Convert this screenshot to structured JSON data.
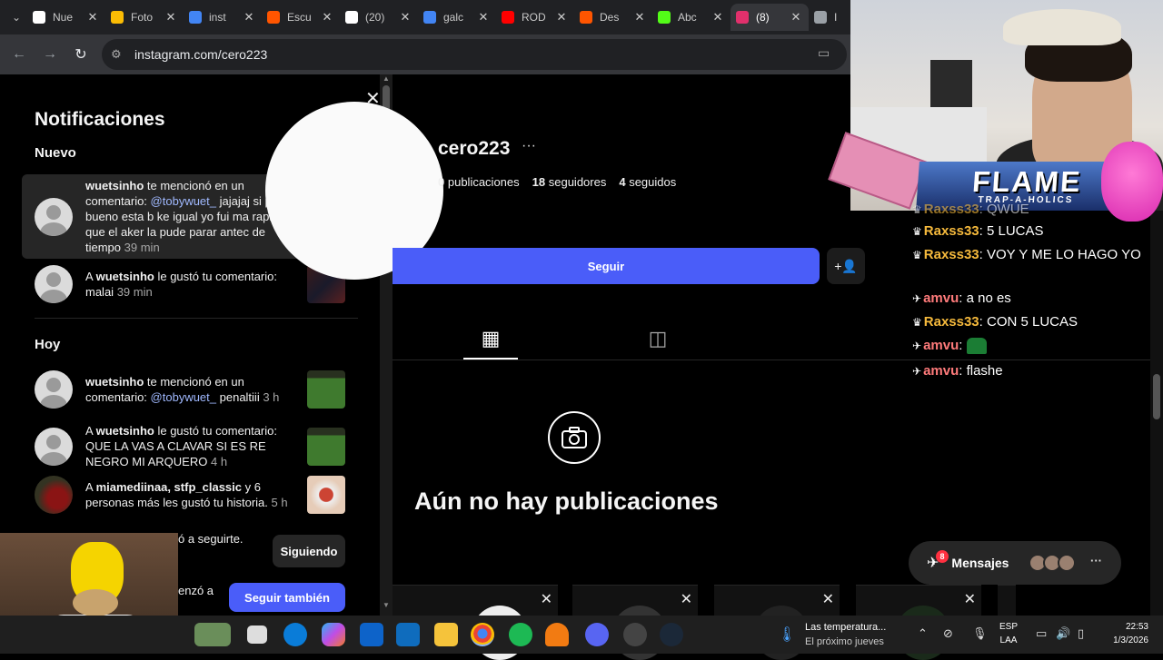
{
  "browser": {
    "tabs": [
      {
        "label": "Nue",
        "icon": "threads-icon",
        "color": "#ffffff"
      },
      {
        "label": "Foto",
        "icon": "photos-icon",
        "color": "#fbbc04"
      },
      {
        "label": "inst",
        "icon": "google-icon",
        "color": "#4285f4"
      },
      {
        "label": "Escu",
        "icon": "soundcloud-icon",
        "color": "#ff5500"
      },
      {
        "label": "(20)",
        "icon": "tiktok-icon",
        "color": "#ffffff"
      },
      {
        "label": "galc",
        "icon": "google-icon",
        "color": "#4285f4"
      },
      {
        "label": "ROD",
        "icon": "youtube-icon",
        "color": "#ff0000"
      },
      {
        "label": "Des",
        "icon": "soundcloud-icon",
        "color": "#ff5500"
      },
      {
        "label": "Abc",
        "icon": "kick-icon",
        "color": "#53fc18"
      },
      {
        "label": "(8)",
        "icon": "instagram-icon",
        "color": "#e1306c"
      },
      {
        "label": "I",
        "icon": "chrome-icon",
        "color": "#9aa0a6"
      }
    ],
    "url": "instagram.com/cero223"
  },
  "notifications": {
    "title": "Notificaciones",
    "section_new": "Nuevo",
    "section_today": "Hoy",
    "new": [
      {
        "user": "wuetsinho",
        "pre": "",
        "text": " te mencionó en un comentario: ",
        "mention": "@tobywuet_",
        "post": " jajajaj si pa bueno esta b ke igual yo fui ma rapido que el aker la pude parar antec de tiempo",
        "time": "39 min"
      },
      {
        "pre": "A ",
        "user": "wuetsinho",
        "text": " le gustó tu comentario: malai",
        "mention": "",
        "post": "",
        "time": "39 min"
      }
    ],
    "today": [
      {
        "user": "wuetsinho",
        "pre": "",
        "text": " te mencionó en un comentario: ",
        "mention": "@tobywuet_",
        "post": " penaltiii",
        "time": "3 h"
      },
      {
        "pre": "A ",
        "user": "wuetsinho",
        "text": " le gustó tu comentario: QUE LA VAS A CLAVAR SI ES RE NEGRO MI ARQUERO",
        "mention": "",
        "post": "",
        "time": "4 h"
      },
      {
        "pre": "A ",
        "user": "miamediinaa, stfp_classic",
        "text": " y 6 personas más les gustó tu historia.",
        "mention": "",
        "post": "",
        "time": "5 h"
      }
    ],
    "partial1": "ó a seguirte.",
    "partial2": "enzó a",
    "following_label": "Siguiendo",
    "follow_back_label": "Seguir también"
  },
  "profile": {
    "username": "cero223",
    "more": "···",
    "posts_count": "0",
    "posts_label": "publicaciones",
    "followers_count": "18",
    "followers_label": "seguidores",
    "following_count": "4",
    "following_label": "seguidos",
    "follow_label": "Seguir",
    "no_posts": "Aún no hay publicaciones"
  },
  "messages": {
    "label": "Mensajes",
    "badge": "8"
  },
  "stream": {
    "banner_title": "FLAME",
    "banner_sub": "TRAP-A-HOLICS",
    "chat": [
      {
        "user": "Raxss33",
        "msg": "QWUE",
        "color": "#f5b93c"
      },
      {
        "user": "Raxss33",
        "msg": "5 LUCAS",
        "color": "#f5b93c"
      },
      {
        "user": "Raxss33",
        "msg": "VOY Y ME LO HAGO YO",
        "color": "#f5b93c"
      },
      {
        "user": "amvu",
        "msg": "a no es",
        "color": "#ff7b7b"
      },
      {
        "user": "Raxss33",
        "msg": "CON 5 LUCAS",
        "color": "#f5b93c"
      },
      {
        "user": "amvu",
        "msg": "",
        "color": "#ff7b7b"
      },
      {
        "user": "amvu",
        "msg": "flashe",
        "color": "#ff7b7b"
      }
    ]
  },
  "taskbar": {
    "weather_title": "Las temperatura...",
    "weather_sub": "El próximo jueves",
    "lang1": "ESP",
    "lang2": "LAA",
    "time": "22:53",
    "date": "1/3/2026"
  }
}
